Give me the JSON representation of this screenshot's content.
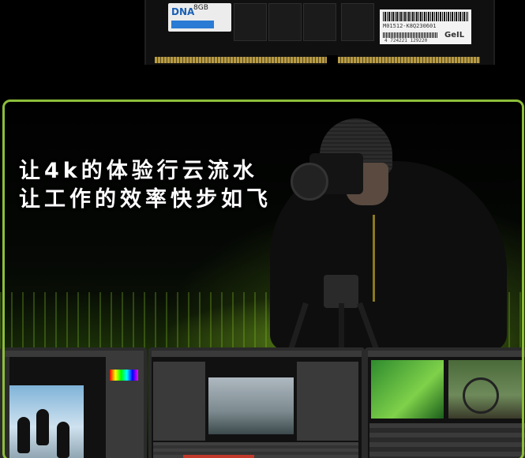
{
  "ram_module": {
    "dna_label": "DNA",
    "capacity": "8GB",
    "serial": "M01512-K8Q230601",
    "brand": "GeIL",
    "barcode_number": "4 724221 129220"
  },
  "banner": {
    "headline_line1": "让4k的体验行云流水",
    "headline_line2": "让工作的效率快步如飞"
  },
  "colors": {
    "frame_green": "#8dbe3a",
    "background": "#000000",
    "headline": "#ffffff"
  },
  "icons": [
    "tripod-icon",
    "camera-icon"
  ]
}
